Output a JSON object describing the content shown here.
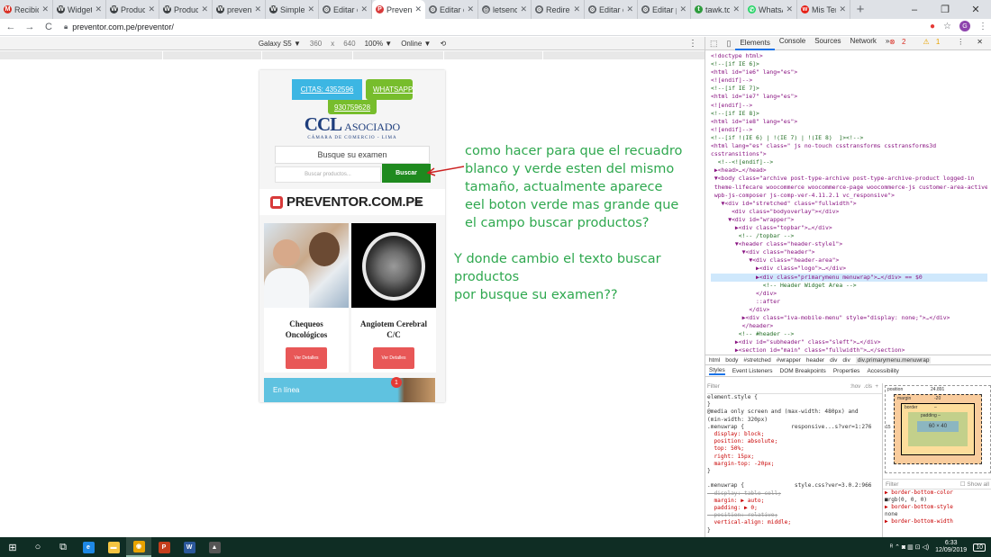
{
  "browser": {
    "tabs": [
      {
        "title": "Recibid",
        "icon": "gmail-icon",
        "color": "#d93025",
        "glyph": "M"
      },
      {
        "title": "Widget:",
        "icon": "wordpress-icon",
        "color": "#3c4043",
        "glyph": "W"
      },
      {
        "title": "Product",
        "icon": "wordpress-icon",
        "color": "#3c4043",
        "glyph": "W"
      },
      {
        "title": "Product",
        "icon": "wordpress-icon",
        "color": "#3c4043",
        "glyph": "W"
      },
      {
        "title": "prevent",
        "icon": "wordpress-icon",
        "color": "#3c4043",
        "glyph": "W"
      },
      {
        "title": "Simple",
        "icon": "wordpress-icon",
        "color": "#3c4043",
        "glyph": "W"
      },
      {
        "title": "Editar e",
        "icon": "gear-icon",
        "color": "#5f6368",
        "glyph": "⚙"
      },
      {
        "title": "Preven",
        "icon": "preventor-icon",
        "color": "#d83a3a",
        "glyph": "P",
        "active": true
      },
      {
        "title": "Editar e",
        "icon": "gear-icon",
        "color": "#5f6368",
        "glyph": "⚙"
      },
      {
        "title": "letsenc",
        "icon": "globe-icon",
        "color": "#5f6368",
        "glyph": "◎"
      },
      {
        "title": "Redirec",
        "icon": "gear-icon",
        "color": "#5f6368",
        "glyph": "⚙"
      },
      {
        "title": "Editar e",
        "icon": "gear-icon",
        "color": "#5f6368",
        "glyph": "⚙"
      },
      {
        "title": "Editar p",
        "icon": "gear-icon",
        "color": "#5f6368",
        "glyph": "⚙"
      },
      {
        "title": "tawk.to",
        "icon": "tawk-icon",
        "color": "#2e9c3d",
        "glyph": "t"
      },
      {
        "title": "WhatsA",
        "icon": "whatsapp-icon",
        "color": "#25d366",
        "glyph": "✆"
      },
      {
        "title": "Mis Ter",
        "icon": "mail-icon",
        "color": "#e62117",
        "glyph": "w"
      }
    ],
    "new_tab": "+",
    "window_controls": [
      "–",
      "❐",
      "✕"
    ],
    "url": "preventor.com.pe/preventor/",
    "nav_back": "←",
    "nav_forward": "→",
    "nav_reload": "C",
    "avatar_letter": "G"
  },
  "device_toolbar": {
    "device": "Galaxy S5 ▼",
    "width": "360",
    "x": "x",
    "height": "640",
    "zoom": "100% ▼",
    "network": "Online ▼",
    "rotate": "⟲",
    "more": "⋮"
  },
  "page": {
    "citas_button": "CITAS: 4352596",
    "whatsapp_button": "WHATSAPP:",
    "whatsapp_number": "930759628",
    "logo_ccl": "CCL",
    "logo_asociado": "ASOCIADO",
    "logo_subtitle": "CÁMARA DE COMERCIO - LIMA",
    "search_box_text": "Busque su examen",
    "products_placeholder": "Buscar productos...",
    "buscar_button": "Buscar",
    "brand": "PREVENTOR.COM.PE",
    "menu_icon": "≡",
    "products": [
      {
        "name": "Chequeos Oncológicos",
        "button": "Ver Detalles"
      },
      {
        "name": "Angiotem Cerebral C/C",
        "button": "Ver Detalles"
      }
    ],
    "chat_label": "En línea",
    "chat_badge": "1"
  },
  "annotations": {
    "question_1": "como hacer para que el recuadro\nblanco y verde esten del mismo\ntamaño, actualmente aparece\neel boton verde mas grande que\nel campo buscar productos?",
    "question_2": "Y donde cambio el texto buscar productos\npor busque su examen??",
    "arrow_color": "#cc2222"
  },
  "devtools": {
    "tabs": [
      "Elements",
      "Console",
      "Sources",
      "Network",
      "»"
    ],
    "active_tab": "Elements",
    "errors": "2",
    "warnings": "1",
    "dom_lines": [
      "<!doctype html>",
      "<!--[if IE 6]>",
      "<html id=\"ie6\" lang=\"es\">",
      "<![endif]-->",
      "<!--[if IE 7]>",
      "<html id=\"ie7\" lang=\"es\">",
      "<![endif]-->",
      "<!--[if IE 8]>",
      "<html id=\"ie8\" lang=\"es\">",
      "<![endif]-->",
      "<!--[if !(IE 6) | !(IE 7) | !(IE 8)  ]><!-->",
      "<html lang=\"es\" class=\" js no-touch csstransforms csstransforms3d",
      "csstransitions\">",
      "  <!--<![endif]-->",
      " ▶<head>…</head>",
      " ▼<body class=\"archive post-type-archive post-type-archive-product logged-in",
      " theme-lifecare woocommerce woocommerce-page woocommerce-js customer-area-active",
      " wpb-js-composer js-comp-ver-4.11.2.1 vc_responsive\">",
      "   ▼<div id=\"stretched\" class=\"fullwidth\">",
      "      <div class=\"bodyoverlay\"></div>",
      "     ▼<div id=\"wrapper\">",
      "       ▶<div class=\"topbar\">…</div>",
      "        <!-- /topbar -->",
      "       ▼<header class=\"header-style1\">",
      "         ▼<div class=\"header\">",
      "           ▼<div class=\"header-area\">",
      "             ▶<div class=\"logo\">…</div>",
      "             ▶<div class=\"primarymenu menuwrap\">…</div> == $0",
      "               <!-- Header Widget Area -->",
      "             </div>",
      "             ::after",
      "           </div>",
      "         ▶<div class=\"iva-mobile-menu\" style=\"display: none;\">…</div>",
      "         </header>",
      "        <!-- #header -->",
      "       ▶<div id=\"subheader\" class=\"sleft\">…</div>",
      "       ▶<section id=\"main\" class=\"fullwidth\">…</section>",
      "        <!-- #main -->"
    ],
    "breadcrumbs": [
      "html",
      "body",
      "#stretched",
      "#wrapper",
      "header",
      "div",
      "div",
      "div.primarymenu.menuwrap"
    ],
    "subtabs": [
      "Styles",
      "Event Listeners",
      "DOM Breakpoints",
      "Properties",
      "Accessibility"
    ],
    "styles_filter": "Filter",
    "styles_filter_right": ":hov  .cls  +",
    "styles_lines": [
      {
        "t": "element.style {",
        "c": "sel"
      },
      {
        "t": "}",
        "c": "sel"
      },
      {
        "t": "@media only screen and (max-width: 480px) and",
        "c": "sel"
      },
      {
        "t": "(min-width: 320px)",
        "c": "sel"
      },
      {
        "t": ".menuwrap {              responsive...s?ver=1:276",
        "c": "sel"
      },
      {
        "t": "  display: block;",
        "c": "prop"
      },
      {
        "t": "  position: absolute;",
        "c": "prop"
      },
      {
        "t": "  top: 50%;",
        "c": "prop"
      },
      {
        "t": "  right: 15px;",
        "c": "prop"
      },
      {
        "t": "  margin-top: -20px;",
        "c": "prop"
      },
      {
        "t": "}",
        "c": "sel"
      },
      {
        "t": "",
        "c": "sel"
      },
      {
        "t": ".menuwrap {               style.css?ver=3.0.2:966",
        "c": "sel"
      },
      {
        "t": "  display: table-cell;",
        "c": "strike"
      },
      {
        "t": "  margin: ▶ auto;",
        "c": "prop"
      },
      {
        "t": "  padding: ▶ 0;",
        "c": "prop"
      },
      {
        "t": "  position: relative;",
        "c": "strike"
      },
      {
        "t": "  vertical-align: middle;",
        "c": "prop"
      },
      {
        "t": "}",
        "c": "sel"
      }
    ],
    "box_model": {
      "position_label": "position",
      "position_value": "24.891",
      "margin_label": "margin",
      "margin_value": "-20",
      "border_label": "border",
      "border_value": "–",
      "padding_label": "padding –",
      "content": "60 × 40",
      "left_value": "15"
    },
    "computed_filter": "Filter",
    "show_all": "Show all",
    "computed_props": [
      {
        "n": "▶ border-bottom-color",
        "v": "■rgb(0, 0, 0)"
      },
      {
        "n": "▶ border-bottom-style",
        "v": "none"
      },
      {
        "n": "▶ border-bottom-width",
        "v": ""
      }
    ]
  },
  "taskbar": {
    "time": "6:33",
    "date": "12/09/2019",
    "notif_count": "10",
    "tray_text": "ᴿ  ⌃  ◙  ▥  ⊡  ◁)",
    "apps": [
      {
        "name": "start-button",
        "glyph": "⊞",
        "color": ""
      },
      {
        "name": "search-icon",
        "glyph": "○",
        "color": ""
      },
      {
        "name": "task-view-icon",
        "glyph": "⧉",
        "color": ""
      },
      {
        "name": "edge-icon",
        "glyph": "e",
        "color": "#1e88e5"
      },
      {
        "name": "file-explorer-icon",
        "glyph": "▬",
        "color": "#f4c542"
      },
      {
        "name": "chrome-icon",
        "glyph": "◉",
        "color": "#e8a300"
      },
      {
        "name": "powerpoint-icon",
        "glyph": "P",
        "color": "#c43e1c"
      },
      {
        "name": "word-icon",
        "glyph": "W",
        "color": "#2b579a"
      },
      {
        "name": "photos-icon",
        "glyph": "▲",
        "color": "#555555"
      }
    ]
  }
}
